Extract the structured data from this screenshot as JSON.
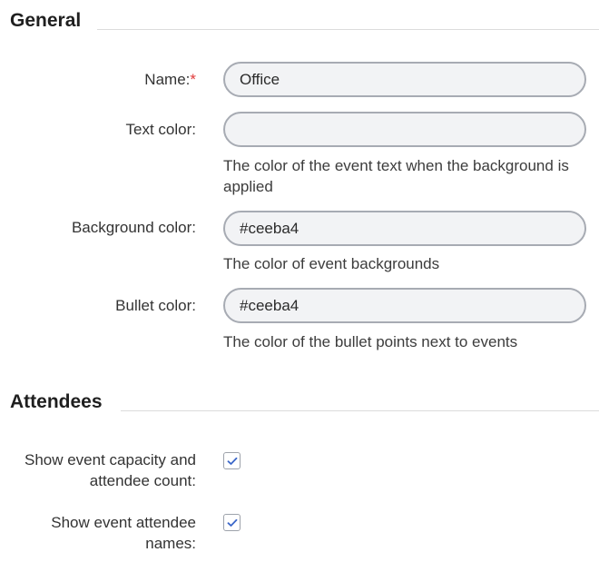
{
  "general": {
    "title": "General",
    "name": {
      "label": "Name:",
      "required_mark": "*",
      "value": "Office"
    },
    "text_color": {
      "label": "Text color:",
      "value": "",
      "help": "The color of the event text when the background is applied"
    },
    "background_color": {
      "label": "Background color:",
      "value": "#ceeba4",
      "help": "The color of event backgrounds"
    },
    "bullet_color": {
      "label": "Bullet color:",
      "value": "#ceeba4",
      "help": "The color of the bullet points next to events"
    }
  },
  "attendees": {
    "title": "Attendees",
    "show_capacity": {
      "label": "Show event capacity and attendee count:",
      "checked": true
    },
    "show_names": {
      "label": "Show event attendee names:",
      "checked": true
    }
  },
  "colors": {
    "accent": "#3b67c9",
    "required": "#e03a3a",
    "field_border": "#a7abb3",
    "field_bg": "#f2f3f5"
  }
}
